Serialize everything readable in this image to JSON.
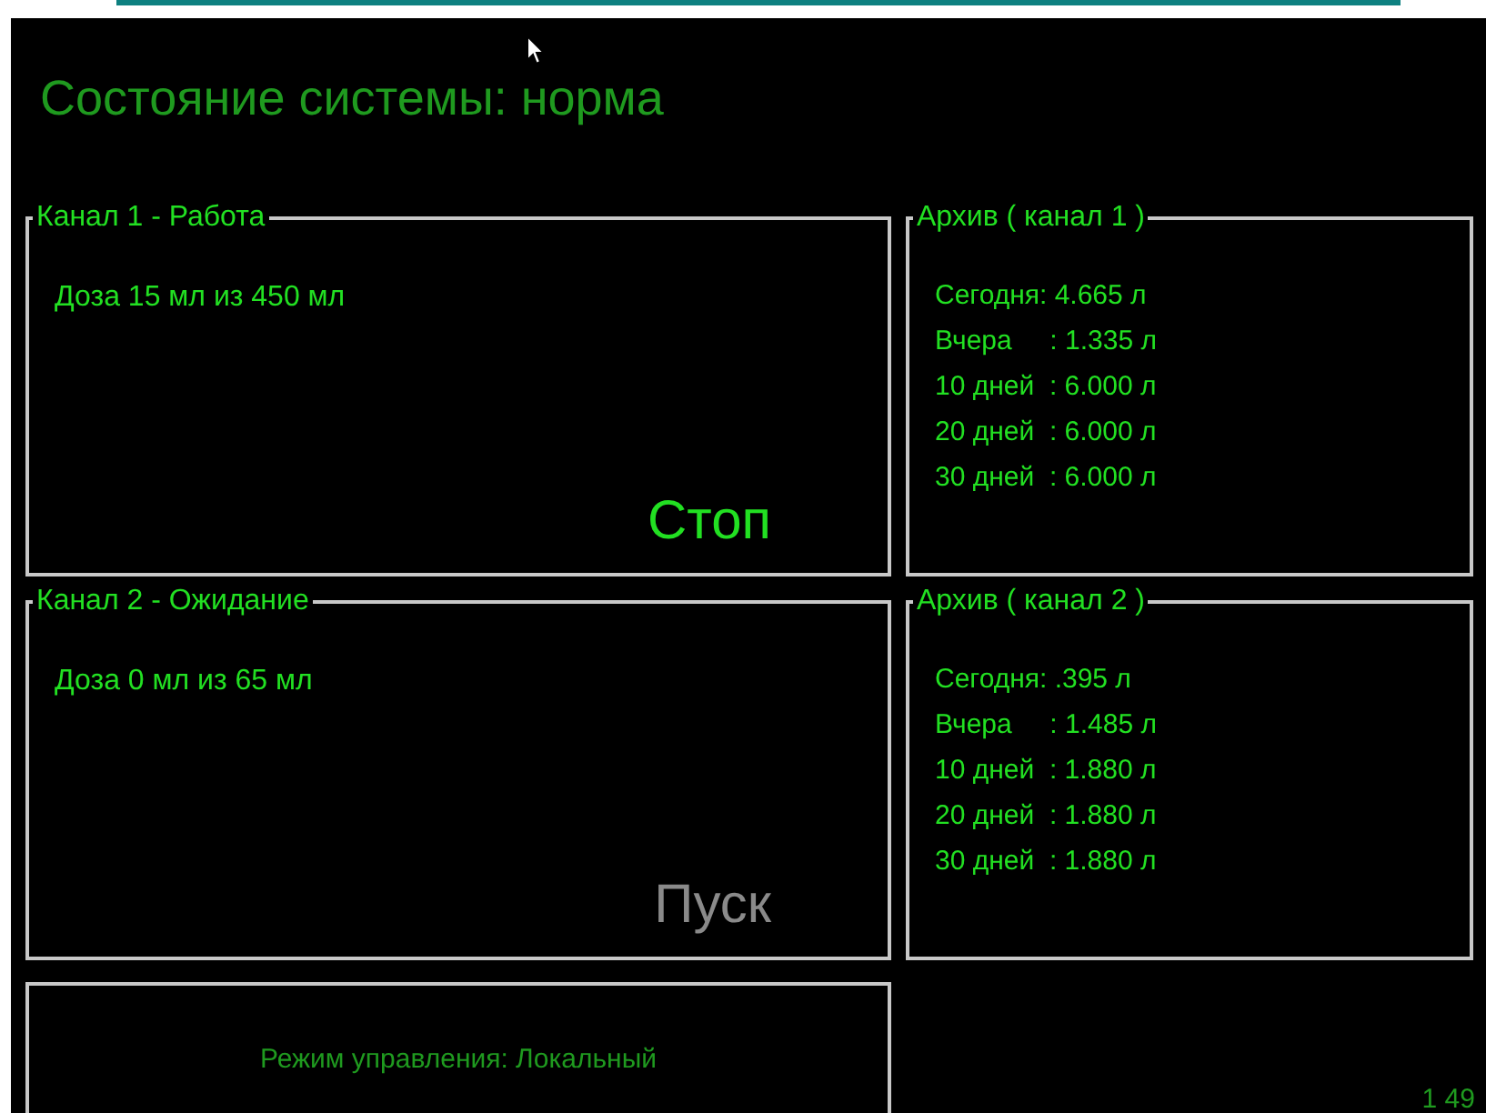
{
  "status_title": "Состояние системы: норма",
  "channels": [
    {
      "legend": "Канал 1  - Работа",
      "dose": "Доза 15 мл из 450 мл",
      "button": "Стоп",
      "active": true
    },
    {
      "legend": "Канал 2 - Ожидание",
      "dose": "Доза 0 мл из 65 мл",
      "button": "Пуск",
      "active": false
    }
  ],
  "archives": [
    {
      "legend": "Архив ( канал 1 )",
      "rows": [
        "Сегодня: 4.665 л",
        "Вчера     : 1.335 л",
        "10 дней  : 6.000 л",
        "20 дней  : 6.000 л",
        "30 дней  : 6.000 л"
      ]
    },
    {
      "legend": "Архив ( канал 2 )",
      "rows": [
        "Сегодня: .395 л",
        "Вчера     : 1.485 л",
        "10 дней  : 1.880 л",
        "20 дней  : 1.880 л",
        "30 дней  : 1.880 л"
      ]
    }
  ],
  "control_mode": "Режим управления:  Локальный",
  "corner_text": "1 49"
}
